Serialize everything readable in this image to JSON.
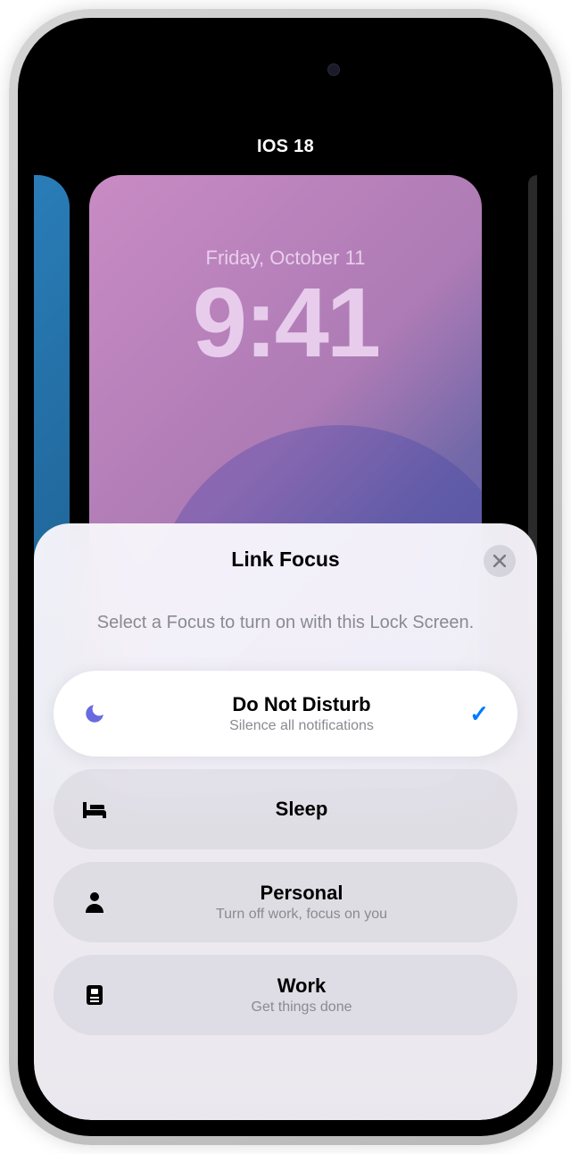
{
  "header": {
    "os_label": "IOS 18"
  },
  "wallpaper": {
    "date": "Friday, October 11",
    "time": "9:41"
  },
  "sheet": {
    "title": "Link Focus",
    "description": "Select a Focus to turn on with this Lock Screen.",
    "focus_options": [
      {
        "title": "Do Not Disturb",
        "subtitle": "Silence all notifications",
        "selected": true
      },
      {
        "title": "Sleep",
        "subtitle": "",
        "selected": false
      },
      {
        "title": "Personal",
        "subtitle": "Turn off work, focus on you",
        "selected": false
      },
      {
        "title": "Work",
        "subtitle": "Get things done",
        "selected": false
      }
    ]
  }
}
